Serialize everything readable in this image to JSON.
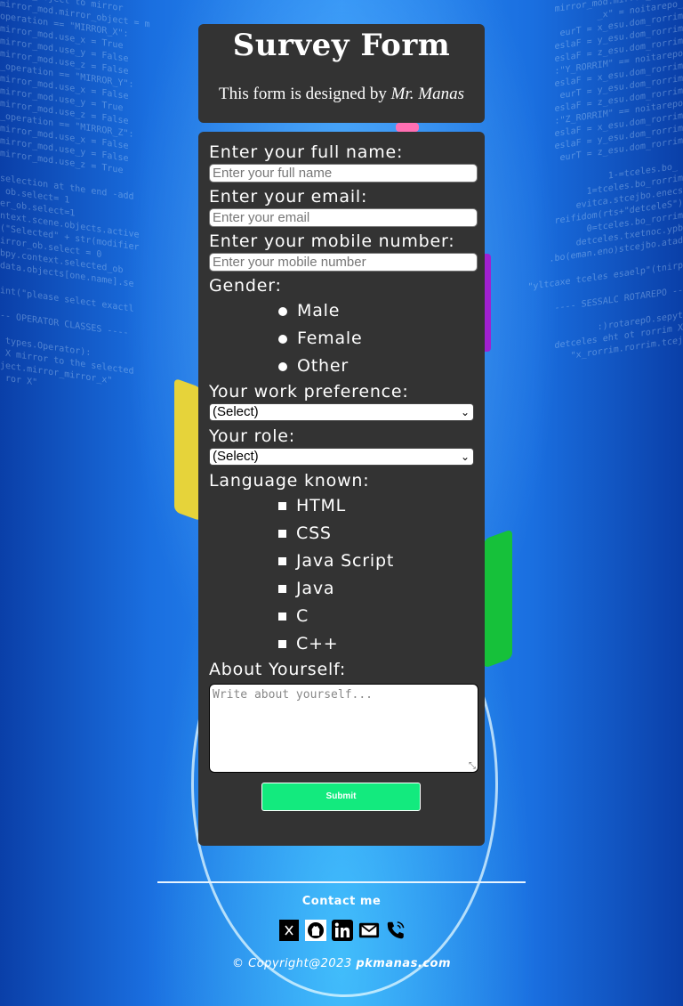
{
  "header": {
    "title": "Survey Form",
    "byline_prefix": "This form is designed by ",
    "byline_name": "Mr. Manas"
  },
  "form": {
    "name_label": "Enter your full name:",
    "name_placeholder": "Enter your full name",
    "email_label": "Enter your email:",
    "email_placeholder": "Enter your email",
    "mobile_label": "Enter your mobile number:",
    "mobile_placeholder": "Enter your mobile number",
    "gender_label": "Gender:",
    "gender_options": [
      "Male",
      "Female",
      "Other"
    ],
    "work_label": "Your work preference:",
    "work_selected": "(Select)",
    "role_label": "Your role:",
    "role_selected": "(Select)",
    "language_label": "Language known:",
    "languages": [
      "HTML",
      "CSS",
      "Java Script",
      "Java",
      "C",
      "C++"
    ],
    "about_label": "About Yourself:",
    "about_placeholder": "Write about yourself...",
    "submit_label": "Submit"
  },
  "footer": {
    "contact_label": "Contact me",
    "social_icons": [
      "x-icon",
      "github-icon",
      "linkedin-icon",
      "gmail-icon",
      "phone-icon"
    ],
    "copyright_prefix": "© Copyright@2023 ",
    "copyright_name": "pkmanas.com"
  }
}
